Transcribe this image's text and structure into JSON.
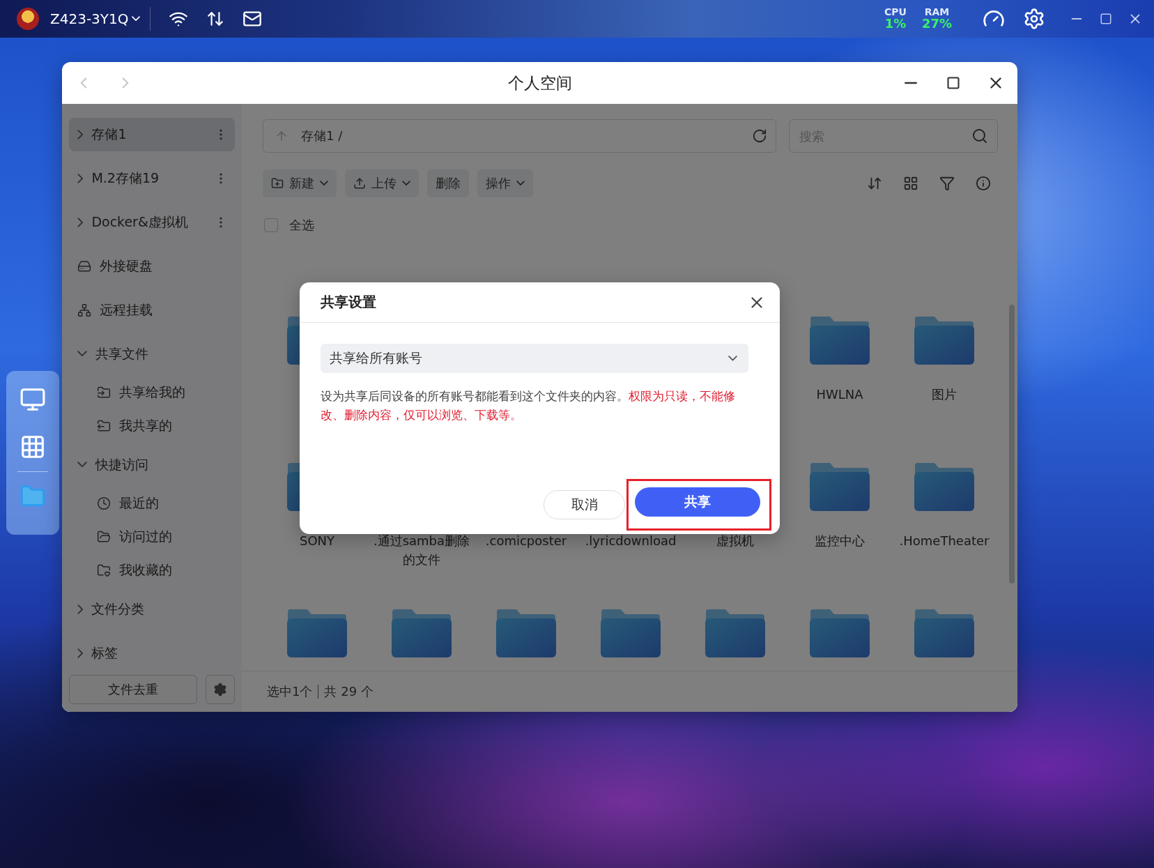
{
  "top_bar": {
    "device_name": "Z423-3Y1Q",
    "cpu": {
      "label": "CPU",
      "value": "1%"
    },
    "ram": {
      "label": "RAM",
      "value": "27%"
    }
  },
  "window": {
    "title": "个人空间"
  },
  "sidebar": {
    "items": [
      {
        "kind": "storage",
        "label": "存储1",
        "selected": true
      },
      {
        "kind": "storage",
        "label": "M.2存储19",
        "selected": false
      },
      {
        "kind": "storage",
        "label": "Docker&虚拟机",
        "selected": false
      },
      {
        "kind": "drive",
        "label": "外接硬盘",
        "selected": false
      },
      {
        "kind": "remote",
        "label": "远程挂载",
        "selected": false
      },
      {
        "kind": "group",
        "label": "共享文件",
        "expanded": true,
        "selected": false,
        "children": [
          {
            "kind": "shared_in",
            "label": "共享给我的",
            "selected": false
          },
          {
            "kind": "shared_out",
            "label": "我共享的",
            "selected": false
          }
        ]
      },
      {
        "kind": "group",
        "label": "快捷访问",
        "expanded": true,
        "selected": false,
        "children": [
          {
            "kind": "recent",
            "label": "最近的",
            "selected": false
          },
          {
            "kind": "visited",
            "label": "访问过的",
            "selected": false
          },
          {
            "kind": "favorites",
            "label": "我收藏的",
            "selected": false
          }
        ]
      },
      {
        "kind": "group",
        "label": "文件分类",
        "expanded": false,
        "selected": false
      },
      {
        "kind": "group",
        "label": "标签",
        "expanded": false,
        "selected": false
      }
    ],
    "dedupe_button": "文件去重"
  },
  "path_bar": {
    "path": "存储1 /"
  },
  "search": {
    "placeholder": "搜索"
  },
  "toolbar": {
    "buttons": [
      {
        "kind": "new",
        "label": "新建",
        "dropdown": true
      },
      {
        "kind": "upload",
        "label": "上传",
        "dropdown": true
      },
      {
        "kind": "plain",
        "label": "删除",
        "dropdown": false
      },
      {
        "kind": "plain",
        "label": "操作",
        "dropdown": true
      }
    ]
  },
  "select_all": {
    "label": "全选",
    "checked": false
  },
  "folder_rows": [
    {
      "items": [
        {
          "kind": "folder"
        },
        {
          "kind": "folder",
          "name": "HWLNA"
        },
        {
          "kind": "folder",
          "name": "图片"
        }
      ]
    },
    {
      "items": [
        {
          "kind": "folder",
          "name": "SONY"
        },
        {
          "kind": "folder",
          "name": ".通过samba删除的文件"
        },
        {
          "kind": "folder",
          "name": ".comicposter"
        },
        {
          "kind": "folder",
          "name": ".lyricdownload"
        },
        {
          "kind": "folder",
          "name": "虚拟机"
        },
        {
          "kind": "folder",
          "name": "监控中心"
        },
        {
          "kind": "folder",
          "name": ".HomeTheater"
        }
      ]
    },
    {
      "items": [
        {
          "kind": "folder"
        },
        {
          "kind": "folder"
        },
        {
          "kind": "folder"
        },
        {
          "kind": "folder"
        },
        {
          "kind": "folder"
        },
        {
          "kind": "folder"
        },
        {
          "kind": "folder"
        }
      ]
    }
  ],
  "status_bar": {
    "selection": "选中1个",
    "total": "共 29 个"
  },
  "dialog": {
    "title": "共享设置",
    "scope": {
      "value": "共享给所有账号"
    },
    "description": "设为共享后同设备的所有账号都能看到这个文件夹的内容。",
    "warning": "权限为只读，不能修改、删除内容，仅可以浏览、下载等。",
    "buttons": [
      {
        "kind": "secondary",
        "label": "取消",
        "highlighted": false
      },
      {
        "kind": "primary",
        "label": "共享",
        "highlighted": true
      }
    ]
  }
}
